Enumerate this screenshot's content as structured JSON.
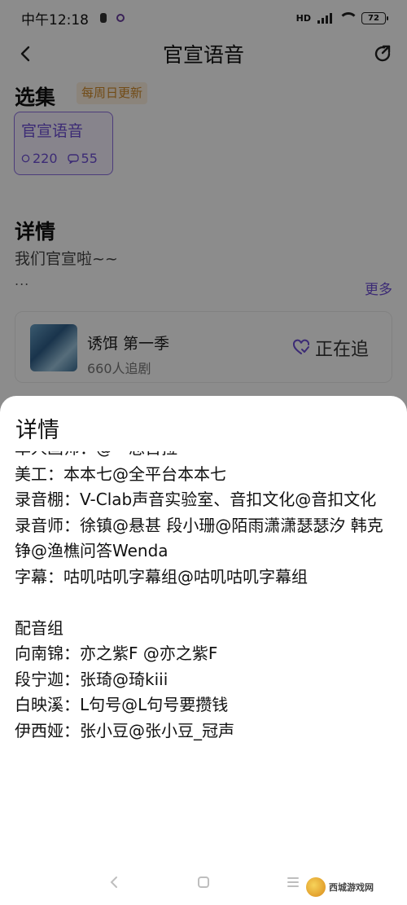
{
  "status_bar": {
    "time": "中午12:18",
    "battery": "72"
  },
  "header": {
    "title": "官宣语音"
  },
  "collection": {
    "section_title": "选集",
    "update_tag": "每周日更新",
    "card": {
      "name": "官宣语音",
      "plays": "220",
      "comments": "55"
    }
  },
  "details": {
    "section_title": "详情",
    "summary": "我们官宣啦~~",
    "ellipsis": "...",
    "more_label": "更多"
  },
  "drama": {
    "name": "诱饵 第一季",
    "followers": "660人追剧",
    "follow_label": "正在追"
  },
  "sheet": {
    "title": "详情",
    "lines": [
      "单人画师：@一总百拉一",
      "美工：本本七@全平台本本七",
      "录音棚：V-Clab声音实验室、音扣文化@音扣文化",
      "录音师：徐镇@悬甚 段小珊@陌雨潇潇瑟瑟汐 韩克铮@渔樵问答Wenda",
      "字幕：咕叽咕叽字幕组@咕叽咕叽字幕组",
      "",
      "配音组",
      "向南锦：亦之紫F @亦之紫F",
      "段宁迦：张琦@琦kiii",
      "白映溪：L句号@L句号要攒钱",
      "伊西娅：张小豆@张小豆_冠声"
    ]
  },
  "watermark": {
    "text": "西城游戏网"
  },
  "colors": {
    "accent": "#6e4fd6",
    "tag_text": "#d08a2a",
    "tag_bg": "#fdf0e0",
    "scrim": "rgba(0,0,0,0.45)"
  }
}
